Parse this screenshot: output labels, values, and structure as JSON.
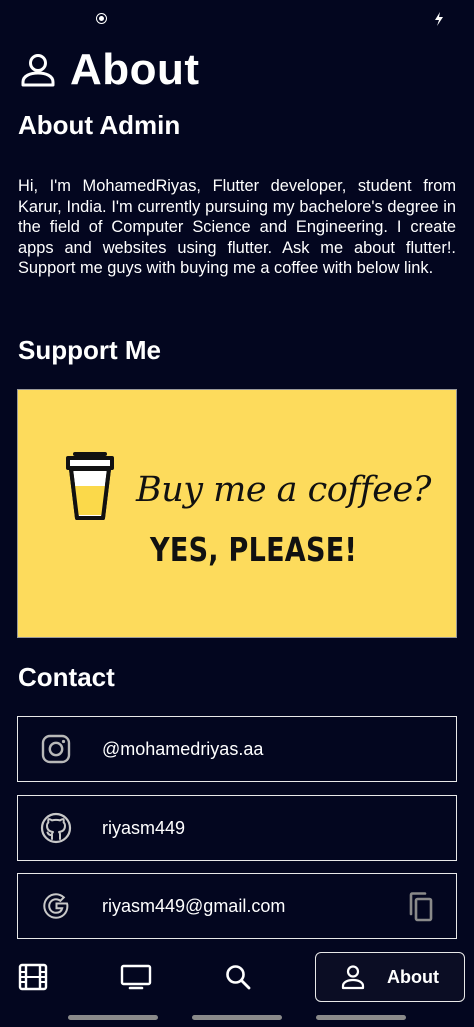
{
  "header": {
    "icon": "person-icon",
    "title": "About"
  },
  "about": {
    "title": "About Admin",
    "bio": "Hi, I'm MohamedRiyas, Flutter developer, student from Karur, India. I'm currently pursuing my bachelore's degree in the field of Computer Science and Engineering. I create apps and websites using flutter. Ask me about flutter!. Support me guys with buying me a coffee with below link."
  },
  "support": {
    "title": "Support Me",
    "banner_line1": "Buy me a coffee?",
    "banner_line2": "YES, PLEASE!",
    "banner_color": "#fddb5c"
  },
  "contact": {
    "title": "Contact",
    "items": [
      {
        "icon": "instagram-icon",
        "label": "@mohamedriyas.aa"
      },
      {
        "icon": "github-icon",
        "label": "riyasm449"
      },
      {
        "icon": "google-icon",
        "label": "riyasm449@gmail.com",
        "action_icon": "copy-icon"
      }
    ]
  },
  "nav": {
    "items": [
      {
        "icon": "movie-film-icon"
      },
      {
        "icon": "tv-icon"
      },
      {
        "icon": "search-icon"
      },
      {
        "icon": "person-icon",
        "label": "About",
        "active": true
      }
    ]
  },
  "colors": {
    "background": "#03061f",
    "text": "#ffffff",
    "border": "#e8e8e8"
  }
}
